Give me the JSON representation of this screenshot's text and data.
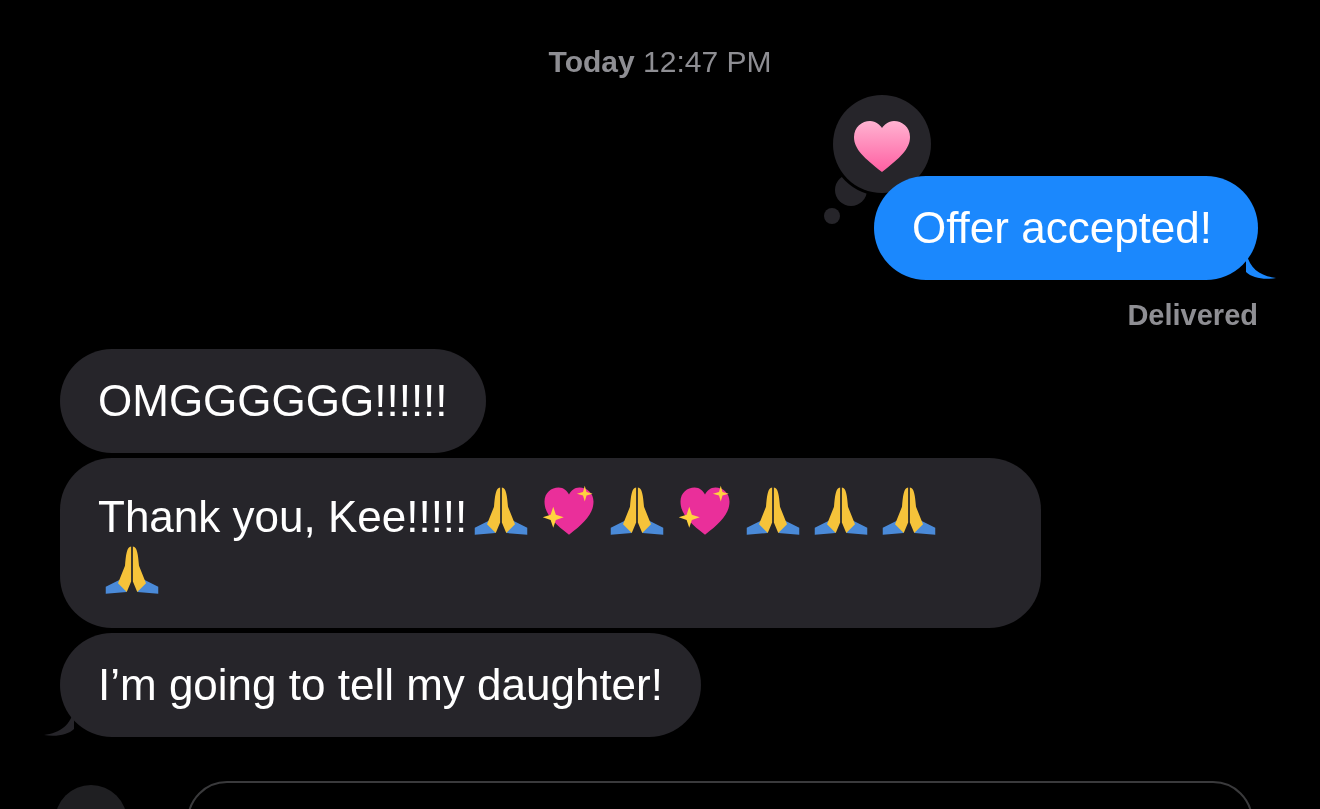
{
  "timestamp": "**Today** 12:47 PM",
  "sent": {
    "text": "Offer accepted!",
    "reaction": {
      "kind": "heart"
    },
    "status": "Delivered"
  },
  "received": [
    {
      "text": "OMGGGGGG!!!!!!"
    },
    {
      "text": "Thank you, Kee!!!!!",
      "emojis": [
        {
          "kind": "pray"
        },
        {
          "kind": "sparkling_heart"
        },
        {
          "kind": "pray"
        },
        {
          "kind": "sparkling_heart"
        },
        {
          "kind": "pray"
        },
        {
          "kind": "pray"
        },
        {
          "kind": "pray"
        },
        {
          "kind": "pray"
        }
      ]
    },
    {
      "text": "I’m going to tell my daughter!"
    }
  ]
}
